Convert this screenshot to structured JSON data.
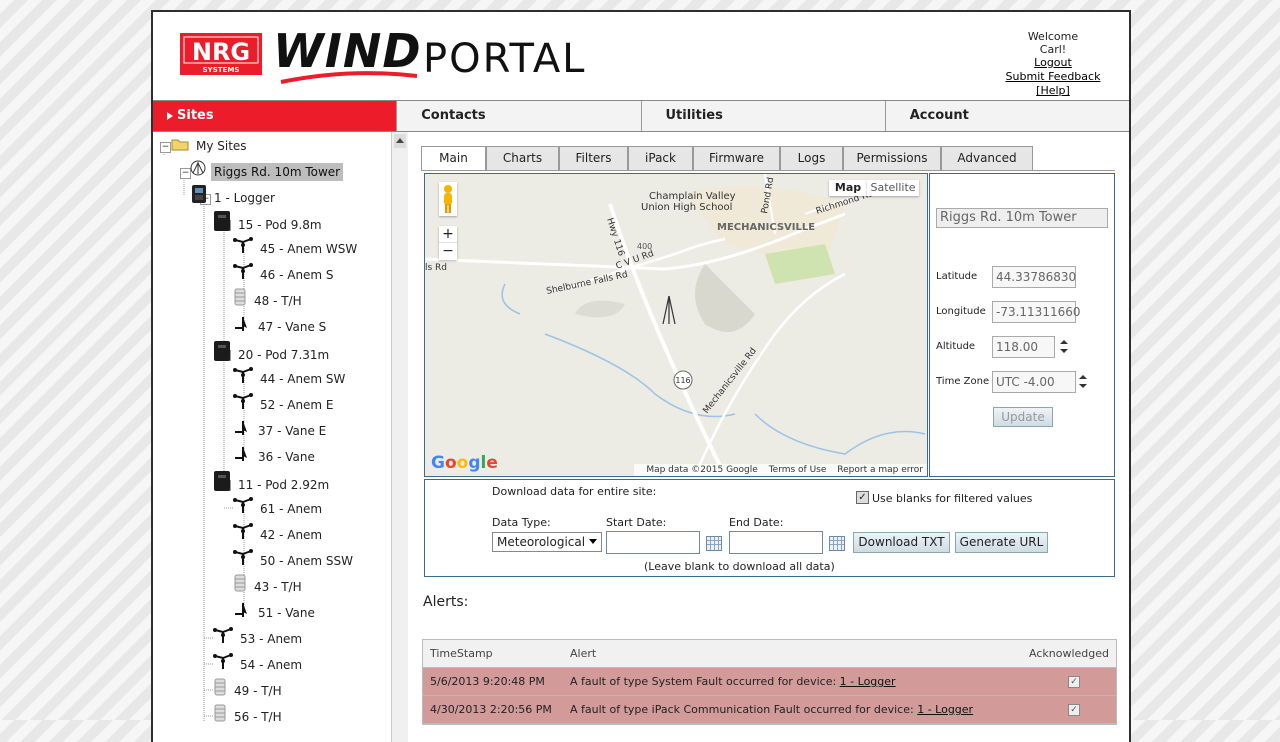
{
  "header": {
    "logo_nrg": "NRG",
    "logo_nrg_sub": "SYSTEMS",
    "logo_wind": "WIND",
    "logo_portal": "PORTAL",
    "welcome": "Welcome Carl!",
    "logout": "Logout",
    "submit_feedback": "Submit Feedback",
    "help": "[Help]",
    "brand_red": "#ec1c2b"
  },
  "nav": {
    "items": [
      {
        "label": "Sites",
        "active": true
      },
      {
        "label": "Contacts"
      },
      {
        "label": "Utilities"
      },
      {
        "label": "Account"
      }
    ]
  },
  "tree": {
    "nodes": [
      {
        "label": "My Sites",
        "icon": "folder-icon"
      },
      {
        "label": "Riggs Rd. 10m Tower",
        "icon": "tower-icon",
        "selected": true
      },
      {
        "label": "1 - Logger",
        "icon": "logger-icon"
      },
      {
        "label": "15 - Pod 9.8m",
        "icon": "pod-icon"
      },
      {
        "label": "45 - Anem WSW",
        "icon": "anemometer-icon"
      },
      {
        "label": "46 - Anem S",
        "icon": "anemometer-icon"
      },
      {
        "label": "48 - T/H",
        "icon": "temp-humidity-icon"
      },
      {
        "label": "47 - Vane S",
        "icon": "vane-icon"
      },
      {
        "label": "20 - Pod 7.31m",
        "icon": "pod-icon"
      },
      {
        "label": "44 - Anem SW",
        "icon": "anemometer-icon"
      },
      {
        "label": "52 - Anem E",
        "icon": "anemometer-icon"
      },
      {
        "label": "37 - Vane E",
        "icon": "vane-icon"
      },
      {
        "label": "36 - Vane",
        "icon": "vane-icon"
      },
      {
        "label": "11 - Pod 2.92m",
        "icon": "pod-icon"
      },
      {
        "label": "61 - Anem",
        "icon": "anemometer-icon"
      },
      {
        "label": "42 - Anem",
        "icon": "anemometer-icon"
      },
      {
        "label": "50 - Anem SSW",
        "icon": "anemometer-icon"
      },
      {
        "label": "43 - T/H",
        "icon": "temp-humidity-icon"
      },
      {
        "label": "51 - Vane",
        "icon": "vane-icon"
      },
      {
        "label": "53 - Anem",
        "icon": "anemometer-icon"
      },
      {
        "label": "54 - Anem",
        "icon": "anemometer-icon"
      },
      {
        "label": "49 - T/H",
        "icon": "temp-humidity-icon"
      },
      {
        "label": "56 - T/H",
        "icon": "temp-humidity-icon"
      }
    ]
  },
  "tabs": [
    "Main",
    "Charts",
    "Filters",
    "iPack",
    "Firmware",
    "Logs",
    "Permissions",
    "Advanced"
  ],
  "map": {
    "map_label": "Map",
    "satellite_label": "Satellite",
    "labels": {
      "school": "Champlain Valley\nUnion High School",
      "town": "MECHANICSVILLE",
      "pond_rd": "Pond Rd",
      "richmond_rd": "Richmond Rd",
      "hwy": "Hwy 116",
      "cvu": "C V U Rd",
      "shelburne": "Shelburne Falls Rd",
      "mechanicsville_rd": "Mechanicsville Rd",
      "route": "116",
      "route2": "400",
      "fls": "ls Rd"
    },
    "google": "Google",
    "footer": {
      "data": "Map data ©2015 Google",
      "terms": "Terms of Use",
      "report": "Report a map error"
    }
  },
  "site": {
    "name": "Riggs Rd. 10m Tower",
    "latitude_label": "Latitude",
    "latitude": "44.33786830",
    "longitude_label": "Longitude",
    "longitude": "-73.11311660",
    "altitude_label": "Altitude",
    "altitude": "118.00",
    "timezone_label": "Time Zone",
    "timezone": "UTC -4.00",
    "update_label": "Update"
  },
  "download": {
    "title": "Download data for entire site:",
    "use_blanks": "Use blanks for filtered values",
    "data_type_label": "Data Type:",
    "data_type": "Meteorological",
    "start_label": "Start Date:",
    "end_label": "End Date:",
    "start_value": "",
    "end_value": "",
    "download_txt": "Download TXT",
    "generate_url": "Generate URL",
    "note": "(Leave blank to download all data)"
  },
  "alerts": {
    "title": "Alerts:",
    "columns": [
      "TimeStamp",
      "Alert",
      "Acknowledged"
    ],
    "rows": [
      {
        "timestamp": "5/6/2013 9:20:48 PM",
        "text": "A fault of type System Fault occurred for device: ",
        "device": "1 - Logger",
        "ack": "✓"
      },
      {
        "timestamp": "4/30/2013 2:20:56 PM",
        "text": "A fault of type iPack Communication Fault occurred for device: ",
        "device": "1 - Logger",
        "ack": "✓"
      }
    ]
  }
}
